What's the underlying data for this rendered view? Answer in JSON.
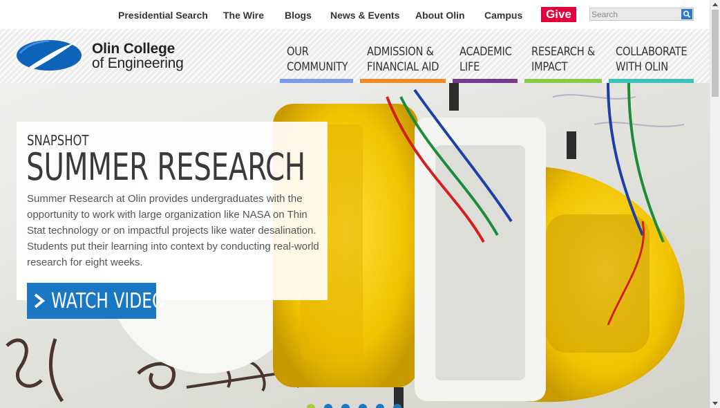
{
  "utility_nav": {
    "links": [
      {
        "label": "Presidential Search"
      },
      {
        "label": "The Wire"
      },
      {
        "label": "Blogs"
      },
      {
        "label": "News & Events"
      },
      {
        "label": "About Olin"
      },
      {
        "label": "Campus"
      }
    ],
    "give_label": "Give",
    "search_placeholder": "Search",
    "search_icon": "magnifier-icon"
  },
  "brand": {
    "name_line1": "Olin College",
    "name_line2": "of Engineering",
    "logo_icon": "olin-swoosh-logo"
  },
  "main_nav": {
    "items": [
      {
        "line1": "OUR",
        "line2": "COMMUNITY",
        "color": "#7d9be6"
      },
      {
        "line1": "ADMISSION &",
        "line2": "FINANCIAL AID",
        "color": "#f08a24"
      },
      {
        "line1": "ACADEMIC",
        "line2": "LIFE",
        "color": "#7a3a8a"
      },
      {
        "line1": "RESEARCH &",
        "line2": "IMPACT",
        "color": "#8acc4a"
      },
      {
        "line1": "COLLABORATE",
        "line2": "WITH OLIN",
        "color": "#3fc3b8"
      }
    ]
  },
  "hero": {
    "kicker": "SNAPSHOT",
    "title": "SUMMER RESEARCH",
    "description": "Summer Research at Olin provides undergraduates with the opportunity to work with large organization like NASA on Thin Stat technology or on impactful projects like water desalination. Students put their learning into context by conducting real-world research for eight weeks.",
    "cta_label": "WATCH VIDEO",
    "cta_icon": "chevron-right-icon",
    "slides_count": 6,
    "active_slide": 1
  },
  "colors": {
    "brand_blue": "#1a77c4",
    "give_red": "#e4003b",
    "active_dot": "#a6cc37"
  }
}
